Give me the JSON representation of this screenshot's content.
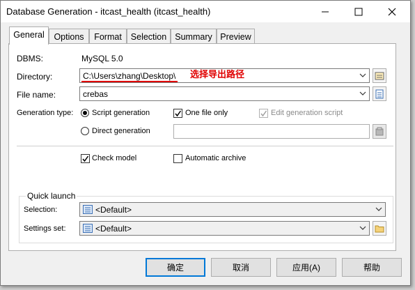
{
  "window": {
    "title": "Database Generation - itcast_health (itcast_health)"
  },
  "tabs": [
    {
      "label": "General"
    },
    {
      "label": "Options"
    },
    {
      "label": "Format"
    },
    {
      "label": "Selection"
    },
    {
      "label": "Summary"
    },
    {
      "label": "Preview"
    }
  ],
  "general": {
    "dbms_label": "DBMS:",
    "dbms_value": "MySQL 5.0",
    "directory_label": "Directory:",
    "directory_value": "C:\\Users\\zhang\\Desktop\\",
    "annotation": "选择导出路径",
    "filename_label": "File name:",
    "filename_value": "crebas",
    "gentype_label": "Generation type:",
    "script_generation": "Script generation",
    "direct_generation": "Direct generation",
    "one_file_only": "One file only",
    "edit_generation_script": "Edit generation script",
    "check_model": "Check model",
    "automatic_archive": "Automatic archive"
  },
  "quick_launch": {
    "title": "Quick launch",
    "selection_label": "Selection:",
    "selection_value": "<Default>",
    "settings_label": "Settings set:",
    "settings_value": "<Default>"
  },
  "buttons": {
    "ok": "确定",
    "cancel": "取消",
    "apply": "应用(A)",
    "help": "帮助"
  },
  "colors": {
    "annotation": "#e00000",
    "accent": "#0078d7"
  }
}
